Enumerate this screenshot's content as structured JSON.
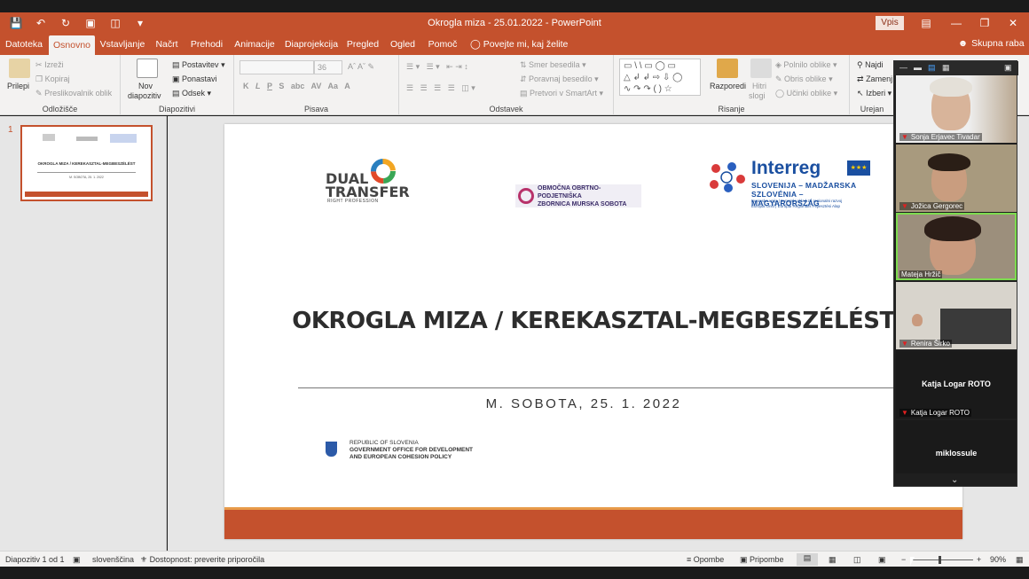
{
  "window": {
    "title": "Okrogla miza - 25.01.2022  -  PowerPoint",
    "signin_label": "Vpis"
  },
  "tabs": [
    {
      "label": "Datoteka"
    },
    {
      "label": "Osnovno"
    },
    {
      "label": "Vstavljanje"
    },
    {
      "label": "Načrt"
    },
    {
      "label": "Prehodi"
    },
    {
      "label": "Animacije"
    },
    {
      "label": "Diaprojekcija"
    },
    {
      "label": "Pregled"
    },
    {
      "label": "Ogled"
    },
    {
      "label": "Pomoč"
    }
  ],
  "tellme": "Povejte mi, kaj želite narediti",
  "share_label": "Skupna raba",
  "ribbon": {
    "clipboard": {
      "label": "Odložišče",
      "paste": "Prilepi",
      "cut": "Izreži",
      "copy": "Kopiraj",
      "format_painter": "Preslikovalnik oblik"
    },
    "slides": {
      "label": "Diapozitivi",
      "new_slide_1": "Nov",
      "new_slide_2": "diapozitiv",
      "layout": "Postavitev",
      "reset": "Ponastavi",
      "section": "Odsek"
    },
    "font": {
      "label": "Pisava",
      "size": "36"
    },
    "paragraph": {
      "label": "Odstavek",
      "text_direction": "Smer besedila",
      "align_text": "Poravnaj besedilo",
      "smartart": "Pretvori v SmartArt"
    },
    "drawing": {
      "label": "Risanje",
      "arrange": "Razporedi",
      "quick_styles_1": "Hitri",
      "quick_styles_2": "slogi",
      "shape_fill": "Polnilo oblike",
      "shape_outline": "Obris oblike",
      "shape_effects": "Učinki oblike"
    },
    "editing": {
      "label": "Urejan",
      "find": "Najdi",
      "replace": "Zamenj",
      "select": "Izberi"
    }
  },
  "thumbnail": {
    "number": "1",
    "title": "OKROGLA MIZA / KEREKASZTAL-MEGBESZÉLÉST",
    "date": "M. SOBOTA, 25. 1. 2022"
  },
  "slide": {
    "logo_dual_1": "DUAL",
    "logo_dual_2": "TRANSFER",
    "logo_dual_sub": "RIGHT PROFESSION",
    "logo_obrt_1": "OBMOČNA OBRTNO-PODJETNIŠKA",
    "logo_obrt_2": "ZBORNICA MURSKA SOBOTA",
    "interreg_word": "Interreg",
    "interreg_line1": "SLOVENIJA – MADŽARSKA",
    "interreg_line2": "SZLOVÉNIA – MAGYARORSZÁG",
    "interreg_line3": "Evropska unija | Evropski sklad za regionalni razvoj",
    "interreg_line4": "Európai Unió | Európai Regionális Fejlesztési Alap",
    "title": "OKROGLA MIZA / KEREKASZTAL-MEGBESZÉLÉST",
    "date": "M. SOBOTA, 25. 1. 2022",
    "gov_1": "REPUBLIC OF SLOVENIA",
    "gov_2": "GOVERNMENT OFFICE FOR DEVELOPMENT",
    "gov_3": "AND EUROPEAN COHESION POLICY"
  },
  "status": {
    "slide_count": "Diapozitiv 1 od 1",
    "language": "slovenščina",
    "accessibility": "Dostopnost: preverite priporočila",
    "notes": "Opombe",
    "comments": "Pripombe",
    "zoom": "90%"
  },
  "participants": [
    {
      "name": "Sonja Erjavec Tivadar"
    },
    {
      "name": "Jožica Gergorec"
    },
    {
      "name": "Mateja Hržič"
    },
    {
      "name": "Renira Širko"
    },
    {
      "name": "Katja Logar ROTO"
    },
    {
      "name": "miklossule"
    }
  ]
}
